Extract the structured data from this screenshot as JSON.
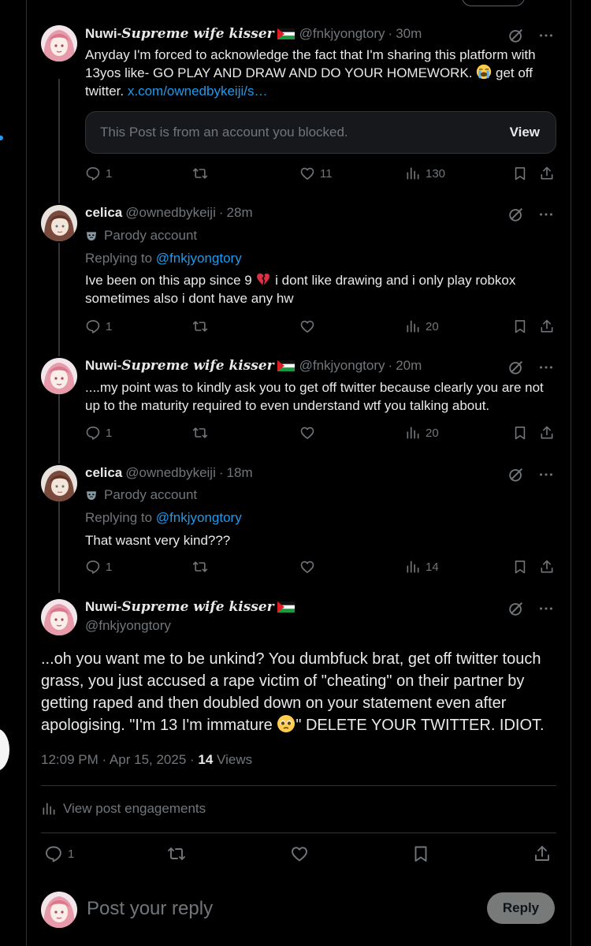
{
  "posts": [
    {
      "name": "Nuwi-",
      "name_suffix": "Supreme wife kisser",
      "handle": "@fnkjyongtory",
      "time": "30m",
      "text_before_emoji": "Anyday I'm forced to acknowledge the fact that I'm sharing this platform with 13yos like- GO PLAY AND DRAW AND DO YOUR HOMEWORK.",
      "emoji": "loudly-crying-face",
      "text_after_emoji": " get off twitter.",
      "link": "x.com/ownedbykeiji/s…",
      "quote": {
        "text": "This Post is from an account you blocked.",
        "button": "View"
      },
      "replies": "1",
      "reposts": "",
      "likes": "11",
      "views": "130"
    },
    {
      "name": "celica",
      "handle": "@ownedbykeiji",
      "time": "28m",
      "parody_label": "Parody account",
      "replying_label": "Replying to",
      "replying_to": "@fnkjyongtory",
      "text_before_emoji": "Ive been on this app since 9",
      "emoji": "broken-heart",
      "text_after_emoji": " i dont like drawing and i only play robkox sometimes also i dont have any hw",
      "replies": "1",
      "reposts": "",
      "likes": "",
      "views": "20"
    },
    {
      "name": "Nuwi-",
      "name_suffix": "Supreme wife kisser",
      "handle": "@fnkjyongtory",
      "time": "20m",
      "text": "....my point was to kindly ask you to get off twitter because clearly you are not up to the maturity required to even understand wtf you talking about.",
      "replies": "1",
      "reposts": "",
      "likes": "",
      "views": "20"
    },
    {
      "name": "celica",
      "handle": "@ownedbykeiji",
      "time": "18m",
      "parody_label": "Parody account",
      "replying_label": "Replying to",
      "replying_to": "@fnkjyongtory",
      "text": "That wasnt very kind???",
      "replies": "1",
      "reposts": "",
      "likes": "",
      "views": "14"
    }
  ],
  "main_post": {
    "name": "Nuwi-",
    "name_suffix": "Supreme wife kisser",
    "handle": "@fnkjyongtory",
    "text_before_emoji": "...oh you want me to be unkind? You dumbfuck brat, get off twitter touch grass, you just accused a rape victim of \"cheating\" on their partner by getting raped and then doubled down on your statement even after apologising.  \"I'm 13 I'm immature",
    "emoji": "pleading-face",
    "text_after_emoji": "\" DELETE YOUR TWITTER. IDIOT.",
    "timestamp": "12:09 PM · Apr 15, 2025 · ",
    "views_count": "14",
    "views_label": " Views",
    "engagements_label": "View post engagements",
    "replies": "1"
  },
  "reply_bar": {
    "placeholder": "Post your reply",
    "button": "Reply"
  },
  "colors": {
    "background": "#000000",
    "text": "#e7e9ea",
    "muted": "#71767b",
    "link": "#1d9bf0",
    "border": "#2f3336"
  }
}
